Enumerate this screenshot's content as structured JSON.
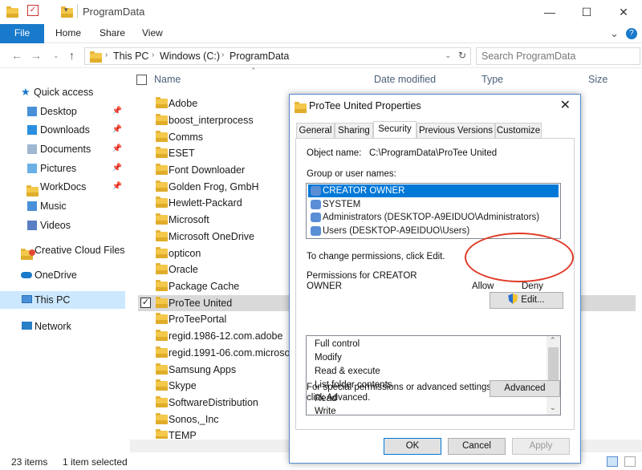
{
  "window": {
    "title": "ProgramData",
    "controls": {
      "minimize": "—",
      "maximize": "☐",
      "close": "✕"
    }
  },
  "ribbon": {
    "file": "File",
    "tabs": [
      "Home",
      "Share",
      "View"
    ],
    "collapse": "⌄",
    "help": "?"
  },
  "address": {
    "crumbs": [
      "This PC",
      "Windows (C:)",
      "ProgramData"
    ],
    "search_placeholder": "Search ProgramData"
  },
  "nav": {
    "items": [
      "Quick access",
      "Desktop",
      "Downloads",
      "Documents",
      "Pictures",
      "WorkDocs",
      "Music",
      "Videos",
      "Creative Cloud Files",
      "OneDrive",
      "This PC",
      "Network"
    ]
  },
  "columns": {
    "name": "Name",
    "date": "Date modified",
    "type": "Type",
    "size": "Size"
  },
  "files": [
    "Adobe",
    "boost_interprocess",
    "Comms",
    "ESET",
    "Font Downloader",
    "Golden Frog, GmbH",
    "Hewlett-Packard",
    "Microsoft",
    "Microsoft OneDrive",
    "opticon",
    "Oracle",
    "Package Cache",
    "ProTee United",
    "ProTeePortal",
    "regid.1986-12.com.adobe",
    "regid.1991-06.com.microsoft",
    "Samsung Apps",
    "Skype",
    "SoftwareDistribution",
    "Sonos,_Inc",
    "TEMP"
  ],
  "status": {
    "count": "23 items",
    "selected": "1 item selected"
  },
  "dialog": {
    "title": "ProTee United Properties",
    "close": "✕",
    "tabs": [
      "General",
      "Sharing",
      "Security",
      "Previous Versions",
      "Customize"
    ],
    "object_label": "Object name:",
    "object_value": "C:\\ProgramData\\ProTee United",
    "group_label": "Group or user names:",
    "users": [
      "CREATOR OWNER",
      "SYSTEM",
      "Administrators (DESKTOP-A9EIDUO\\Administrators)",
      "Users (DESKTOP-A9EIDUO\\Users)"
    ],
    "change_text": "To change permissions, click Edit.",
    "edit_btn": "Edit...",
    "perm_for_line1": "Permissions for CREATOR",
    "perm_for_line2": "OWNER",
    "allow": "Allow",
    "deny": "Deny",
    "permissions": [
      "Full control",
      "Modify",
      "Read & execute",
      "List folder contents",
      "Read",
      "Write"
    ],
    "special_line1": "For special permissions or advanced settings,",
    "special_line2": "click Advanced.",
    "advanced_btn": "Advanced",
    "ok": "OK",
    "cancel": "Cancel",
    "apply": "Apply"
  },
  "colors": {
    "accent": "#1979ca",
    "selection": "#0078d7",
    "annotation": "#e03a27"
  }
}
